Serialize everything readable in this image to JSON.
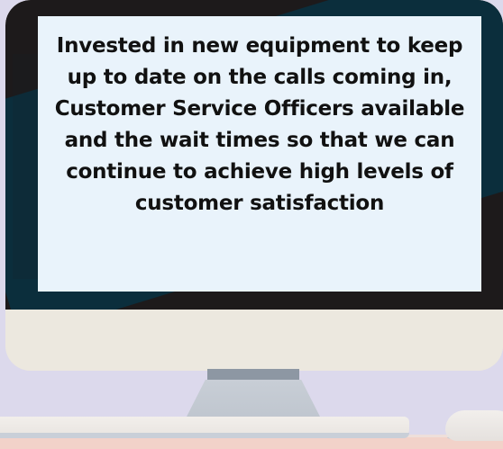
{
  "message": {
    "text": "Invested in new equipment to keep up to date on the calls coming in, Customer Service Officers available and the wait times so that we can continue to achieve high levels of customer satisfaction"
  },
  "colors": {
    "background": "#dcd9ec",
    "screen_dark": "#1d1a1b",
    "screen_teal": "#0b2e3c",
    "card": "#e9f3fb",
    "bezel": "#ece8df",
    "desk": "#f2d2c9"
  }
}
